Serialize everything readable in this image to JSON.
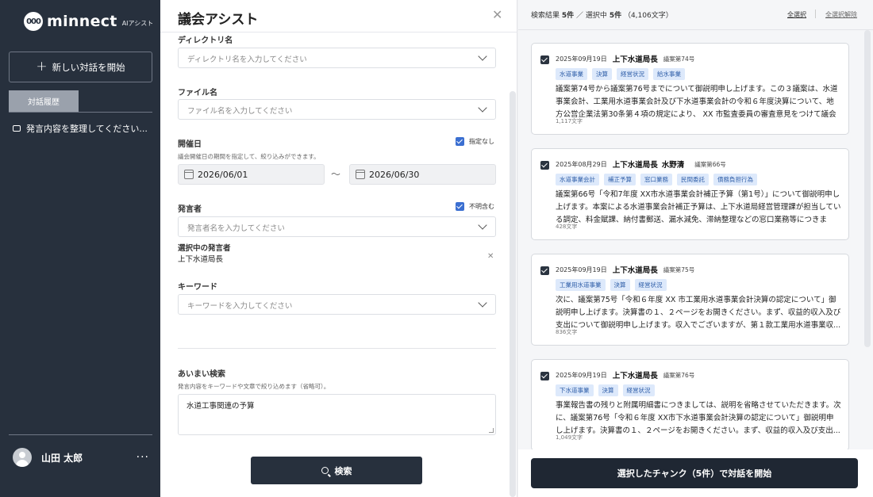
{
  "sidebar": {
    "logo_mark": "000",
    "logo_text": "minnect",
    "logo_sub": "AIアシスト",
    "new_chat_label": "新しい対話を開始",
    "history_tab": "対話履歴",
    "history_items": [
      "発言内容を整理してください..."
    ],
    "user_name": "山田 太郎",
    "user_more": "···"
  },
  "form": {
    "title": "議会アシスト",
    "directory": {
      "label": "ディレクトリ名",
      "placeholder": "ディレクトリ名を入力してください"
    },
    "file": {
      "label": "ファイル名",
      "placeholder": "ファイル名を入力してください"
    },
    "date": {
      "label": "開催日",
      "hint": "議会開催日の期間を指定して、絞り込みができます。",
      "nospec_label": "指定なし",
      "start": "2026/06/01",
      "tilde": "〜",
      "end": "2026/06/30"
    },
    "speaker": {
      "label": "発言者",
      "include_unknown": "不明含む",
      "placeholder": "発言者名を入力してください",
      "selected_label": "選択中の発言者",
      "selected_value": "上下水道局長"
    },
    "keyword": {
      "label": "キーワード",
      "placeholder": "キーワードを入力してください"
    },
    "fuzzy": {
      "label": "あいまい検索",
      "hint": "発言内容をキーワードや文章で絞り込めます（省略可）。",
      "value": "水道工事関連の予算"
    },
    "search_label": "検索"
  },
  "results": {
    "summary_prefix": "検索結果",
    "result_count": "5件",
    "summary_sep": "／",
    "selected_prefix": "選択中",
    "selected_count": "5件",
    "char_total": "（4,106文字）",
    "select_all": "全選択",
    "deselect_all": "全選択解除",
    "cards": [
      {
        "date": "2025年09月19日",
        "speaker": "上下水道局長",
        "speaker2": "",
        "agenda": "議案第74号",
        "tags": [
          "水道事業",
          "決算",
          "経営状況",
          "給水事業"
        ],
        "body": "議案第74号から議案第76号までについて御説明申し上げます。この３議案は、水道事業会計、工業用水道事業会計及び下水道事業会計の令和６年度決算について、地方公営企業法第30条第４項の規定により、 XX 市監査委員の審査意見をつけて議会の...",
        "chars": "1,117文字"
      },
      {
        "date": "2025年08月29日",
        "speaker": "上下水道局長",
        "speaker2": "水野清",
        "agenda": "議案第66号",
        "tags": [
          "水道事業会計",
          "補正予算",
          "窓口業務",
          "民間委託",
          "債務負担行為"
        ],
        "body": "議案第66号「令和7年度 XX市水道事業会計補正予算（第1号）」について御説明申し上げます。本案による水道事業会計補正予算は、上下水道局経営管理課が担当している調定、料金賦課、納付書郵送、漏水減免、滞納整理などの窓口業務等につきまし...",
        "chars": "428文字"
      },
      {
        "date": "2025年09月19日",
        "speaker": "上下水道局長",
        "speaker2": "",
        "agenda": "議案第75号",
        "tags": [
          "工業用水道事業",
          "決算",
          "経営状況"
        ],
        "body": "次に、議案第75号「令和６年度 XX 市工業用水道事業会計決算の認定について」御説明申し上げます。決算書の１、２ページをお開きください。まず、収益的収入及び支出について御説明申し上げます。収入でございますが、第１款工業用水道事業収...",
        "chars": "836文字"
      },
      {
        "date": "2025年09月19日",
        "speaker": "上下水道局長",
        "speaker2": "",
        "agenda": "議案第76号",
        "tags": [
          "下水道事業",
          "決算",
          "経営状況"
        ],
        "body": "事業報告書の残りと附属明細書につきましては、説明を省略させていただきます。次に、議案第76号「令和６年度 XX市下水道事業会計決算の認定について」御説明申し上げます。決算書の１、２ページをお開きください。まず、収益的収入及び支出...",
        "chars": "1,049文字"
      }
    ],
    "start_label": "選択したチャンク（5件）で対話を開始"
  }
}
